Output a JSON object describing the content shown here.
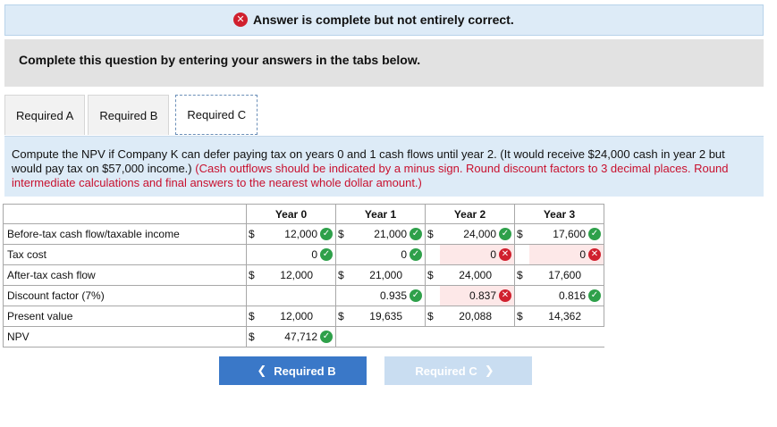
{
  "banner": {
    "text": "Answer is complete but not entirely correct."
  },
  "instructions": {
    "text": "Complete this question by entering your answers in the tabs below."
  },
  "tabs": [
    {
      "label": "Required A",
      "active": false
    },
    {
      "label": "Required B",
      "active": false
    },
    {
      "label": "Required C",
      "active": true
    }
  ],
  "question": {
    "text": "Compute the NPV if Company K can defer paying tax on years 0 and 1 cash flows until year 2. (It would receive $24,000 cash in year 2 but would pay tax on $57,000 income.)",
    "note": "(Cash outflows should be indicated by a minus sign. Round discount factors to 3 decimal places. Round intermediate calculations and final answers to the nearest whole dollar amount.)"
  },
  "table": {
    "headers": [
      "Year 0",
      "Year 1",
      "Year 2",
      "Year 3"
    ],
    "currency_symbol": "$",
    "rows": [
      {
        "label": "Before-tax cash flow/taxable income",
        "cells": [
          {
            "dollar": true,
            "value": "12,000",
            "status": "correct"
          },
          {
            "dollar": true,
            "value": "21,000",
            "status": "correct"
          },
          {
            "dollar": true,
            "value": "24,000",
            "status": "correct"
          },
          {
            "dollar": true,
            "value": "17,600",
            "status": "correct"
          }
        ]
      },
      {
        "label": "Tax cost",
        "cells": [
          {
            "dollar": false,
            "value": "0",
            "status": "correct"
          },
          {
            "dollar": false,
            "value": "0",
            "status": "correct"
          },
          {
            "dollar": false,
            "value": "0",
            "status": "wrong"
          },
          {
            "dollar": false,
            "value": "0",
            "status": "wrong"
          }
        ]
      },
      {
        "label": "After-tax cash flow",
        "cells": [
          {
            "dollar": true,
            "value": "12,000",
            "status": "none"
          },
          {
            "dollar": true,
            "value": "21,000",
            "status": "none"
          },
          {
            "dollar": true,
            "value": "24,000",
            "status": "none"
          },
          {
            "dollar": true,
            "value": "17,600",
            "status": "none"
          }
        ]
      },
      {
        "label": "Discount factor (7%)",
        "cells": [
          {
            "dollar": false,
            "value": "",
            "status": "none"
          },
          {
            "dollar": false,
            "value": "0.935",
            "status": "correct"
          },
          {
            "dollar": false,
            "value": "0.837",
            "status": "wrong"
          },
          {
            "dollar": false,
            "value": "0.816",
            "status": "correct"
          }
        ]
      },
      {
        "label": "Present value",
        "cells": [
          {
            "dollar": true,
            "value": "12,000",
            "status": "none"
          },
          {
            "dollar": true,
            "value": "19,635",
            "status": "none"
          },
          {
            "dollar": true,
            "value": "20,088",
            "status": "none"
          },
          {
            "dollar": true,
            "value": "14,362",
            "status": "none"
          }
        ]
      },
      {
        "label": "NPV",
        "cells": [
          {
            "dollar": true,
            "value": "47,712",
            "status": "correct"
          }
        ]
      }
    ]
  },
  "navigation": {
    "prev_label": "Required B",
    "next_label": "Required C",
    "prev_icon": "chevron-left-icon",
    "next_icon": "chevron-right-icon"
  },
  "colors": {
    "correct": "#2ea04a",
    "wrong": "#d0202e",
    "nav_button": "#3a78c8",
    "panel": "#ddebf7"
  }
}
